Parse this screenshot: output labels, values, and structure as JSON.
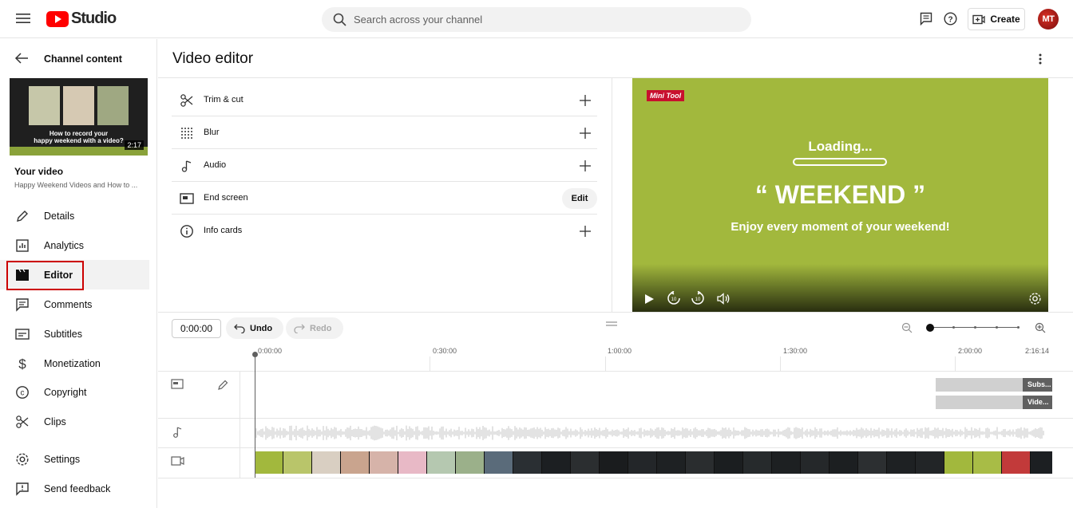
{
  "app": {
    "logo_text": "Studio"
  },
  "search": {
    "placeholder": "Search across your channel"
  },
  "header": {
    "create_label": "Create",
    "avatar_initials": "MT"
  },
  "sidebar": {
    "back_label": "Channel content",
    "thumbnail": {
      "caption_line1": "How to record your",
      "caption_line2": "happy weekend with a video?",
      "duration": "2:17"
    },
    "your_video_label": "Your video",
    "video_title": "Happy Weekend Videos and How to ...",
    "items": [
      {
        "label": "Details",
        "icon": "pencil-icon"
      },
      {
        "label": "Analytics",
        "icon": "analytics-icon"
      },
      {
        "label": "Editor",
        "icon": "clapperboard-icon"
      },
      {
        "label": "Comments",
        "icon": "comment-icon"
      },
      {
        "label": "Subtitles",
        "icon": "subtitles-icon"
      },
      {
        "label": "Monetization",
        "icon": "dollar-icon"
      },
      {
        "label": "Copyright",
        "icon": "copyright-icon"
      },
      {
        "label": "Clips",
        "icon": "scissors-icon"
      },
      {
        "label": "Settings",
        "icon": "gear-icon"
      },
      {
        "label": "Send feedback",
        "icon": "feedback-icon"
      }
    ]
  },
  "main": {
    "title": "Video editor",
    "tools": [
      {
        "label": "Trim & cut",
        "action": "+"
      },
      {
        "label": "Blur",
        "action": "+"
      },
      {
        "label": "Audio",
        "action": "+"
      },
      {
        "label": "End screen",
        "action": "Edit"
      },
      {
        "label": "Info cards",
        "action": "+"
      }
    ]
  },
  "preview": {
    "brand": "Mini Tool",
    "loading_text": "Loading...",
    "headline": "“ WEEKEND ”",
    "subline": "Enjoy every moment of your weekend!",
    "bg_color": "#a2b83d"
  },
  "timeline": {
    "current_time": "0:00:00",
    "undo_label": "Undo",
    "redo_label": "Redo",
    "ruler": [
      "0:00:00",
      "0:30:00",
      "1:00:00",
      "1:30:00",
      "2:00:00",
      "2:16:14"
    ],
    "end_screen_tags": [
      "Subs...",
      "Vide..."
    ],
    "zoom_level": 0
  }
}
